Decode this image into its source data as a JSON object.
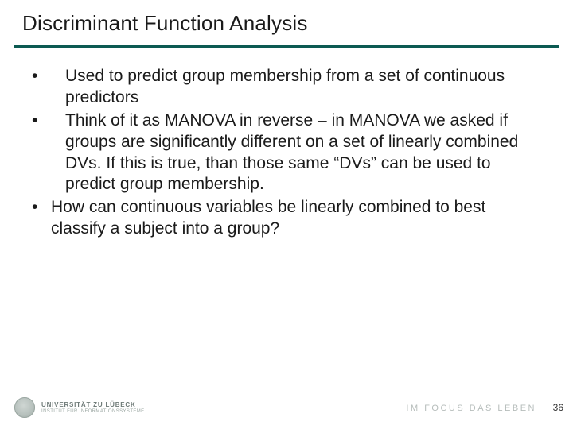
{
  "title": "Discriminant Function Analysis",
  "bullets": [
    {
      "text": "Used to predict group membership from a set of continuous predictors",
      "tight": false
    },
    {
      "text": "Think of it as MANOVA in reverse – in MANOVA we asked if groups are significantly different on a set of linearly combined DVs.  If this is true, than those same “DVs” can be used to predict group membership.",
      "tight": false
    },
    {
      "text": "How can continuous variables be linearly combined to best classify a subject into a group?",
      "tight": true
    }
  ],
  "footer": {
    "university_line1": "UNIVERSITÄT ZU LÜBECK",
    "university_line2": "INSTITUT FÜR INFORMATIONSSYSTEME",
    "tagline": "IM FOCUS DAS LEBEN",
    "page_number": "36"
  },
  "colors": {
    "rule": "#0c5a52"
  }
}
